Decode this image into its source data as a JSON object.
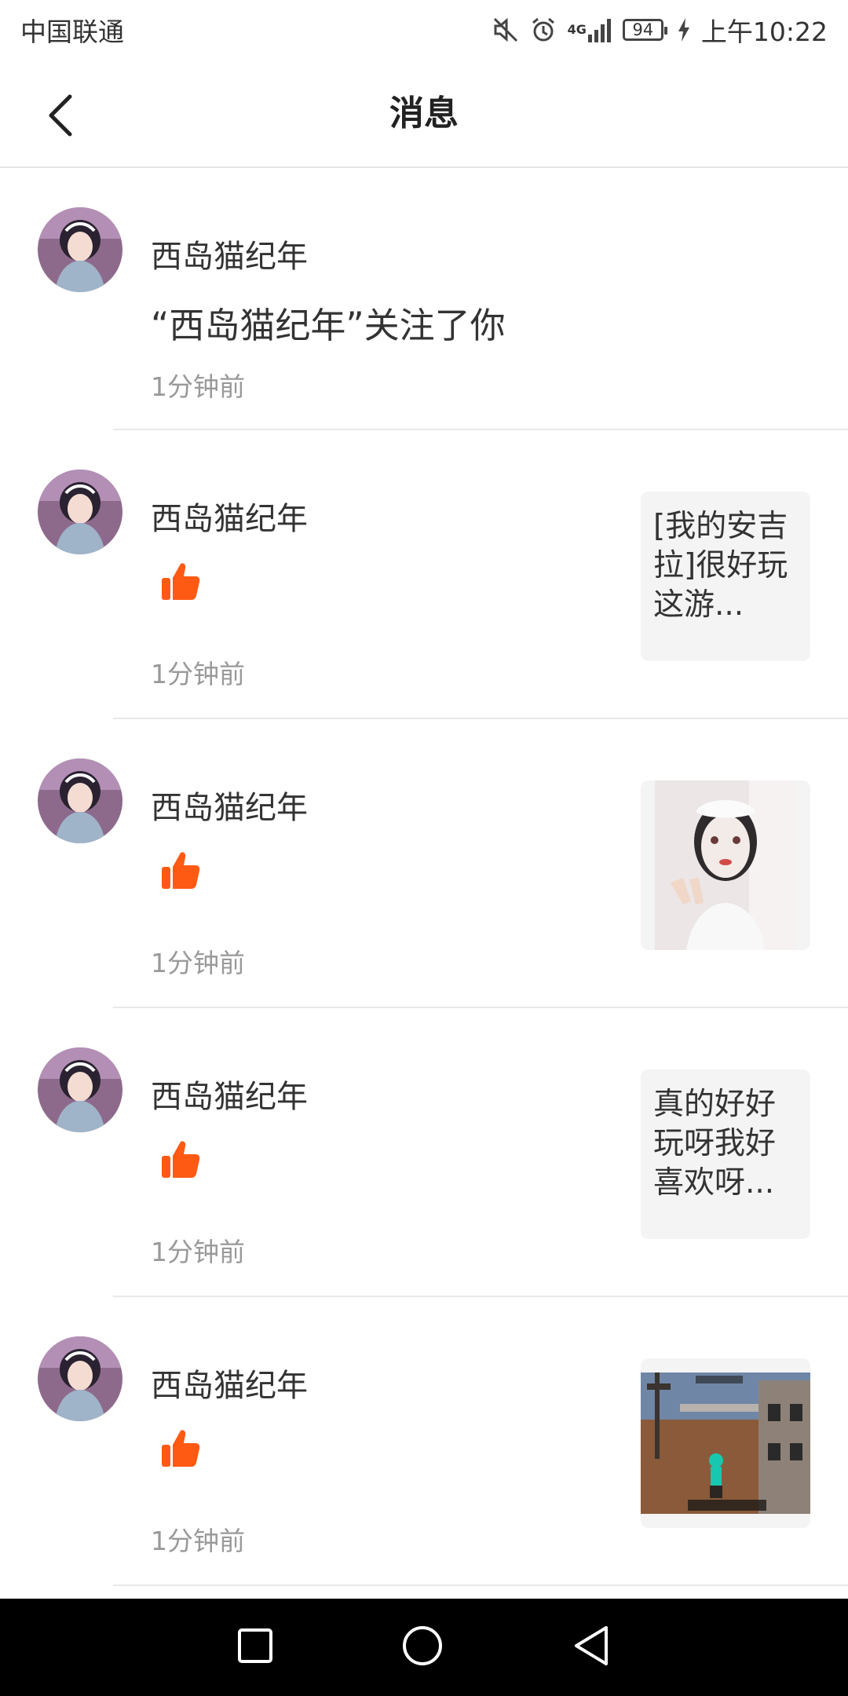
{
  "status_bar": {
    "carrier": "中国联通",
    "network": "4G",
    "battery": "94",
    "time": "上午10:22",
    "icons": [
      "mute-icon",
      "alarm-icon",
      "signal-icon",
      "battery-icon",
      "charging-icon"
    ]
  },
  "header": {
    "title": "消息",
    "back_icon": "chevron-left-icon"
  },
  "messages": [
    {
      "name": "西岛猫纪年",
      "text": "“西岛猫纪年”关注了你",
      "time": "1分钟前"
    },
    {
      "name": "西岛猫纪年",
      "type": "like",
      "time": "1分钟前",
      "thumb_text": "[我的安吉拉]很好玩这游..."
    },
    {
      "name": "西岛猫纪年",
      "type": "like",
      "time": "1分钟前",
      "thumb": "photo-thumbnail"
    },
    {
      "name": "西岛猫纪年",
      "type": "like",
      "time": "1分钟前",
      "thumb_text": "真的好好玩呀我好喜欢呀..."
    },
    {
      "name": "西岛猫纪年",
      "type": "like",
      "time": "1分钟前",
      "thumb": "game-screenshot-thumbnail"
    }
  ],
  "colors": {
    "like": "#ff5a14",
    "time": "#999999",
    "divider": "#e8e8e8"
  },
  "navbar": {
    "icons": [
      "recents-square-icon",
      "home-circle-icon",
      "back-triangle-icon"
    ]
  }
}
